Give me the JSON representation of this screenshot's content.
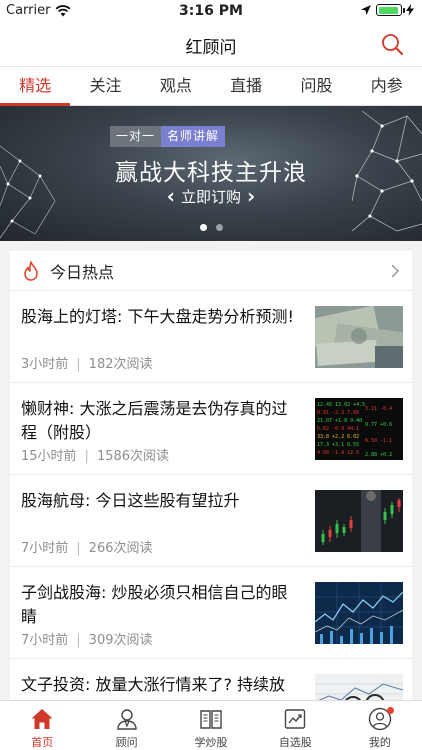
{
  "status_bar": {
    "carrier": "Carrier",
    "time": "3:16 PM",
    "battery_level": 0.95
  },
  "nav": {
    "title": "红顾问"
  },
  "tabs": [
    {
      "label": "精选",
      "active": true
    },
    {
      "label": "关注",
      "active": false
    },
    {
      "label": "观点",
      "active": false
    },
    {
      "label": "直播",
      "active": false
    },
    {
      "label": "问股",
      "active": false
    },
    {
      "label": "内参",
      "active": false
    }
  ],
  "banner": {
    "tag_left": "一对一",
    "tag_right": "名师讲解",
    "headline": "赢战大科技主升浪",
    "cta": "立即订购",
    "page_count": 2,
    "active_page": 1
  },
  "hot": {
    "title": "今日热点",
    "items": [
      {
        "title": "股海上的灯塔: 下午大盘走势分析预测!",
        "time": "3小时前",
        "reads": "182次阅读",
        "thumb": "money"
      },
      {
        "title": "懒财神: 大涨之后震荡是去伪存真的过程（附股）",
        "time": "15小时前",
        "reads": "1586次阅读",
        "thumb": "stock-board"
      },
      {
        "title": "股海航母: 今日这些股有望拉升",
        "time": "7小时前",
        "reads": "266次阅读",
        "thumb": "candlestick"
      },
      {
        "title": "子剑战股海: 炒股必须只相信自己的眼睛",
        "time": "7小时前",
        "reads": "309次阅读",
        "thumb": "blue-chart"
      },
      {
        "title": "文子投资: 放量大涨行情来了? 持续放",
        "time": "",
        "reads": "",
        "thumb": "glasses"
      }
    ]
  },
  "tab_bar": [
    {
      "label": "首页",
      "icon": "home-icon",
      "active": true
    },
    {
      "label": "顾问",
      "icon": "advisor-icon",
      "active": false
    },
    {
      "label": "学炒股",
      "icon": "book-icon",
      "active": false
    },
    {
      "label": "自选股",
      "icon": "chart-icon",
      "active": false
    },
    {
      "label": "我的",
      "icon": "profile-icon",
      "active": false,
      "badge": true
    }
  ],
  "colors": {
    "accent": "#d0382b",
    "banner_tag": "#7b7fd0",
    "battery": "#4cd964"
  }
}
